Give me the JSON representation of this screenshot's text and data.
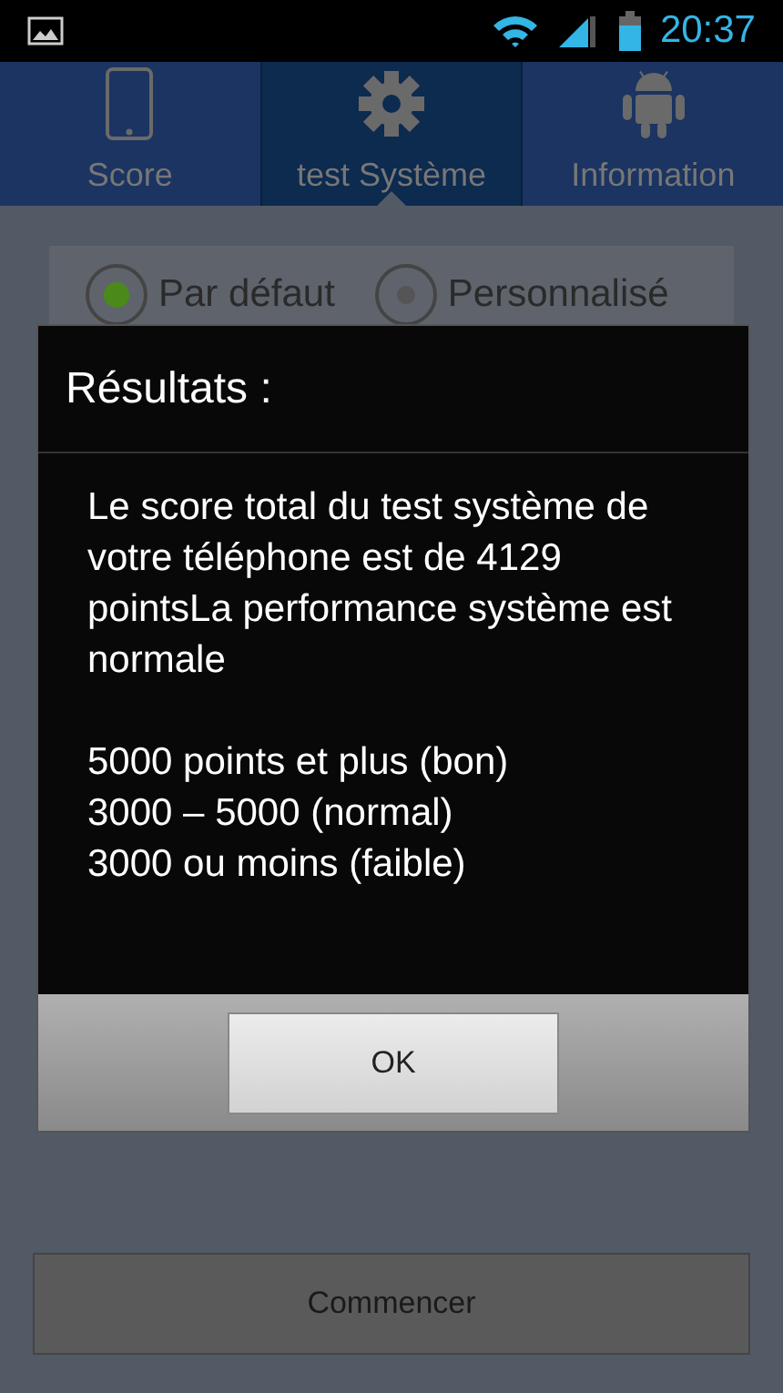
{
  "status_bar": {
    "time": "20:37"
  },
  "tabs": [
    {
      "label": "Score",
      "kind": "phone",
      "selected": false
    },
    {
      "label": "test Système",
      "kind": "gear",
      "selected": true
    },
    {
      "label": "Information",
      "kind": "robot",
      "selected": false
    }
  ],
  "mode_options": [
    {
      "label": "Par défaut",
      "selected": true
    },
    {
      "label": "Personnalisé",
      "selected": false
    }
  ],
  "start_button": "Commencer",
  "dialog": {
    "title": "Résultats :",
    "message": [
      "Le score total du test système de votre téléphone est de 4129 pointsLa performance système est normale",
      "5000 points et plus (bon)",
      "3000 – 5000 (normal)",
      "3000 ou moins (faible)"
    ],
    "button": "OK"
  }
}
